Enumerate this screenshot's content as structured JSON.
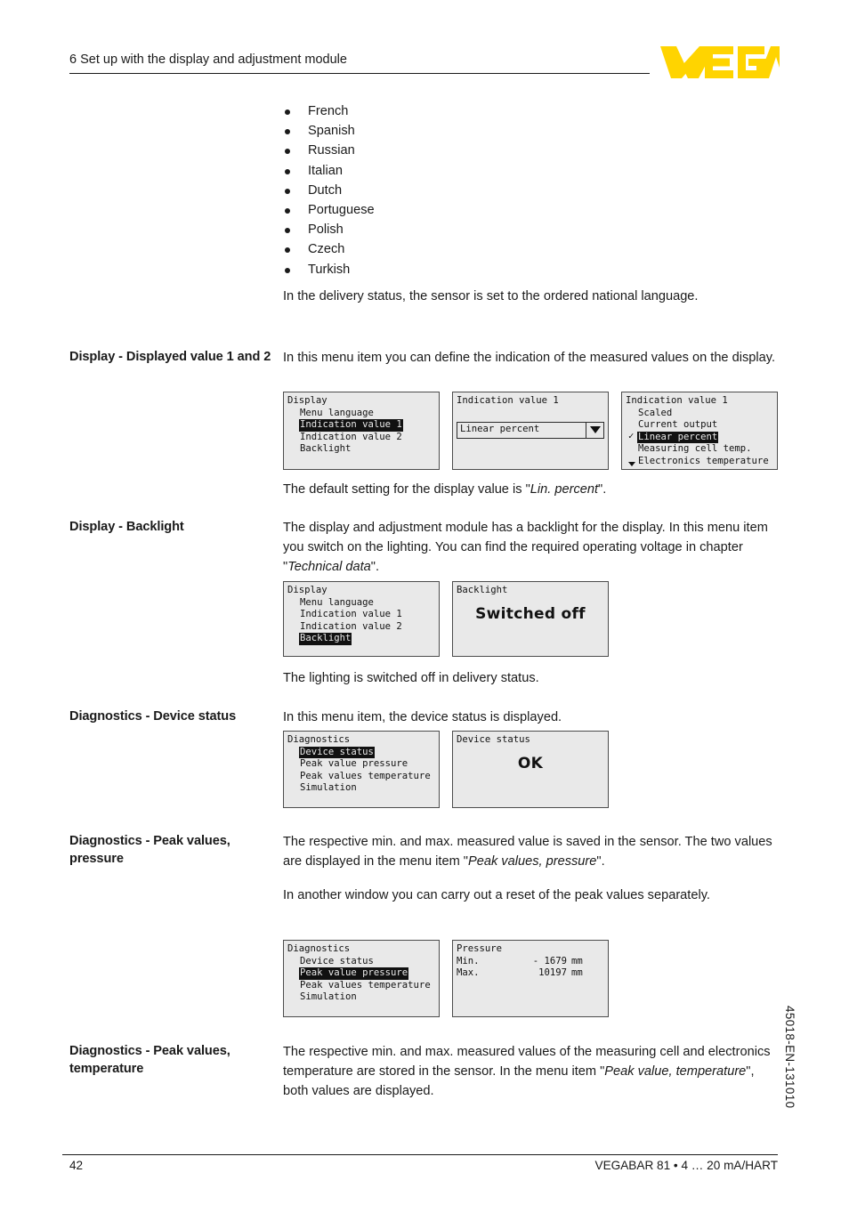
{
  "header": {
    "chapter_title": "6 Set up with the display and adjustment module",
    "logo_text": "VEGA",
    "logo_color": "#FFD400"
  },
  "languages": {
    "items": [
      "French",
      "Spanish",
      "Russian",
      "Italian",
      "Dutch",
      "Portuguese",
      "Polish",
      "Czech",
      "Turkish"
    ]
  },
  "intro": {
    "delivery_status": "In the delivery status, the sensor is set to the ordered national language."
  },
  "sections": {
    "displayed_value": {
      "label": "Display - Displayed value 1 and 2",
      "body": "In this menu item you can define the indication of the measured values on the display.",
      "caption_prefix": "The default setting for the display value is \"",
      "caption_italic": "Lin. percent",
      "caption_suffix": "\"."
    },
    "backlight": {
      "label": "Display - Backlight",
      "body_1": "The display and adjustment module has a backlight for the display. In this menu item you switch on the lighting. You can find the required operating voltage in chapter  \"",
      "body_italic": "Technical data",
      "body_2": "\".",
      "caption": "The lighting is switched off in delivery status."
    },
    "device_status": {
      "label": "Diagnostics - Device status",
      "body": "In this menu item, the device status is displayed."
    },
    "peak_pressure": {
      "label": "Diagnostics - Peak values, pressure",
      "body_1": "The respective min. and max. measured value is saved in the sensor. The two values are displayed in the menu item \"",
      "body_italic": "Peak values, pressure",
      "body_2": "\".",
      "body_3": "In another window you can carry out a reset of the peak values separately."
    },
    "peak_temperature": {
      "label": "Diagnostics - Peak values, temperature",
      "body_1": "The respective min. and max. measured values of the measuring cell and electronics temperature are stored in the sensor. In the menu item \"",
      "body_italic": "Peak value, temperature",
      "body_2": "\", both values are displayed."
    }
  },
  "lcd_panels": {
    "display_menu_1": {
      "title": "Display",
      "items": [
        {
          "label": "Menu language",
          "selected": false
        },
        {
          "label": "Indication value 1",
          "selected": true
        },
        {
          "label": "Indication value 2",
          "selected": false
        },
        {
          "label": "Backlight",
          "selected": false
        }
      ]
    },
    "indication_value_combo": {
      "title": "Indication value 1",
      "value": "Linear percent",
      "arrow": "chevron-down-icon"
    },
    "indication_value_list": {
      "title": "Indication value 1",
      "items": [
        {
          "label": "Scaled",
          "selected": false,
          "checked": false
        },
        {
          "label": "Current output",
          "selected": false,
          "checked": false
        },
        {
          "label": "Linear percent",
          "selected": true,
          "checked": true
        },
        {
          "label": "Measuring cell temp.",
          "selected": false,
          "checked": false
        },
        {
          "label": "Electronics temperature",
          "selected": false,
          "checked": false
        }
      ],
      "more_indicator": "scroll-down-arrow"
    },
    "display_menu_2": {
      "title": "Display",
      "items": [
        {
          "label": "Menu language",
          "selected": false
        },
        {
          "label": "Indication value 1",
          "selected": false
        },
        {
          "label": "Indication value 2",
          "selected": false
        },
        {
          "label": "Backlight",
          "selected": true
        }
      ]
    },
    "backlight_value": {
      "title": "Backlight",
      "value": "Switched off"
    },
    "diagnostics_menu_1": {
      "title": "Diagnostics",
      "items": [
        {
          "label": "Device status",
          "selected": true
        },
        {
          "label": "Peak value pressure",
          "selected": false
        },
        {
          "label": "Peak values temperature",
          "selected": false
        },
        {
          "label": "Simulation",
          "selected": false
        }
      ]
    },
    "device_status_value": {
      "title": "Device status",
      "value": "OK"
    },
    "diagnostics_menu_2": {
      "title": "Diagnostics",
      "items": [
        {
          "label": "Device status",
          "selected": false
        },
        {
          "label": "Peak value pressure",
          "selected": true
        },
        {
          "label": "Peak values temperature",
          "selected": false
        },
        {
          "label": "Simulation",
          "selected": false
        }
      ]
    },
    "pressure_values": {
      "title": "Pressure",
      "rows": [
        {
          "key": "Min.",
          "value": "-  1679",
          "unit": "mm"
        },
        {
          "key": "Max.",
          "value": "10197",
          "unit": "mm"
        }
      ]
    }
  },
  "footer": {
    "page_number": "42",
    "product": "VEGABAR 81 • 4 … 20 mA/HART",
    "doc_code": "45018-EN-131010"
  }
}
